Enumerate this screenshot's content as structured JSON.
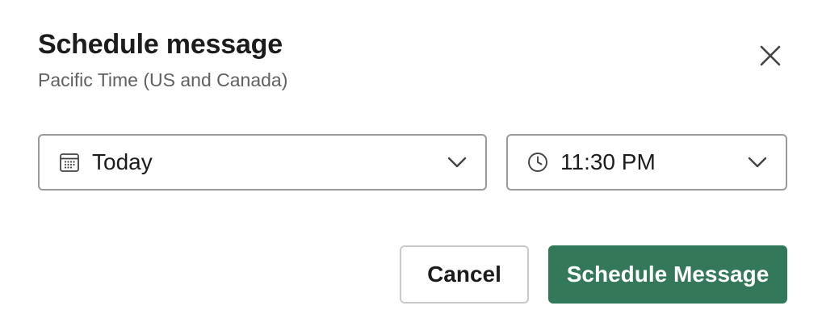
{
  "dialog": {
    "title": "Schedule message",
    "timezone": "Pacific Time (US and Canada)",
    "close_icon": "close-icon"
  },
  "date_select": {
    "icon": "calendar-icon",
    "value": "Today"
  },
  "time_select": {
    "icon": "clock-icon",
    "value": "11:30 PM"
  },
  "actions": {
    "cancel_label": "Cancel",
    "schedule_label": "Schedule Message"
  },
  "colors": {
    "primary": "#34785a",
    "text": "#1d1c1d",
    "muted": "#616061",
    "border": "#9a9a9a"
  }
}
